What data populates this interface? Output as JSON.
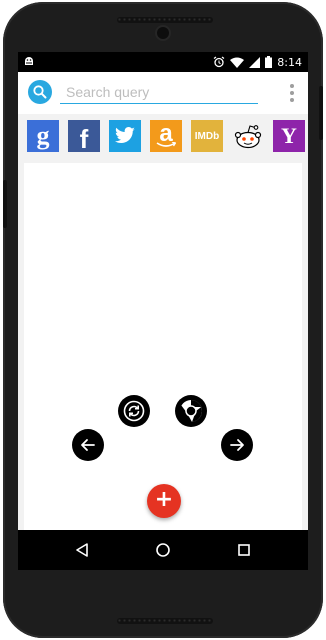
{
  "status_bar": {
    "time": "8:14",
    "left_icon": "android-debug-icon",
    "right_icons": [
      "alarm-icon",
      "wifi-icon",
      "cell-signal-icon",
      "battery-icon"
    ]
  },
  "search": {
    "placeholder": "Search query",
    "value": "",
    "accent_color": "#29a8e0"
  },
  "engines": [
    {
      "name": "Google",
      "label": "g",
      "color": "#3b6fd8",
      "icon": "google-icon"
    },
    {
      "name": "Facebook",
      "label": "f",
      "color": "#3b5998",
      "icon": "facebook-icon"
    },
    {
      "name": "Twitter",
      "label": "",
      "color": "#1da1e2",
      "icon": "twitter-bird-icon"
    },
    {
      "name": "Amazon",
      "label": "a",
      "color": "#f39a1b",
      "icon": "amazon-icon"
    },
    {
      "name": "IMDb",
      "label": "IMDb",
      "color": "#e2b33c",
      "icon": "imdb-icon"
    },
    {
      "name": "Reddit",
      "label": "",
      "color": "#ffffff",
      "icon": "reddit-alien-icon"
    },
    {
      "name": "Yahoo",
      "label": "Y",
      "color": "#8e24aa",
      "icon": "yahoo-icon"
    }
  ],
  "controls": {
    "refresh": "refresh-icon",
    "browser": "chrome-icon",
    "back": "arrow-left-icon",
    "forward": "arrow-right-icon",
    "add_label": "+",
    "add_color": "#e53322"
  },
  "navbar": [
    "back-triangle-icon",
    "home-circle-icon",
    "recents-square-icon"
  ]
}
